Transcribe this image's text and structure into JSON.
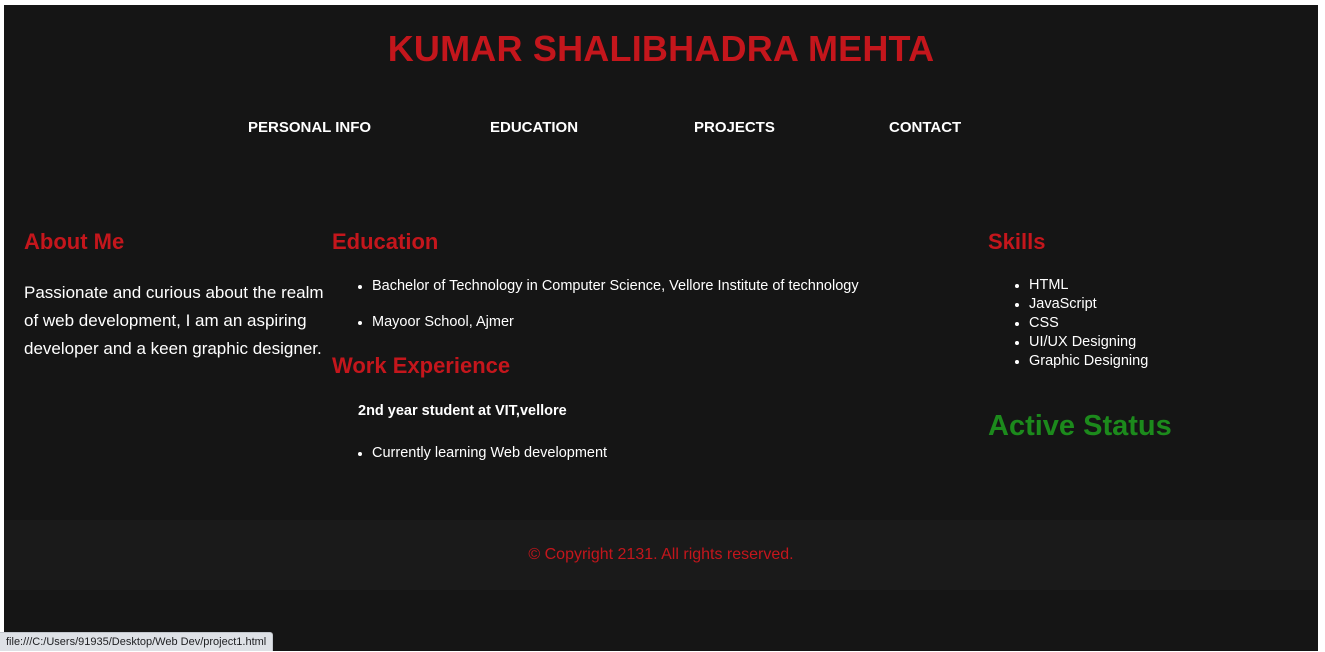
{
  "header": {
    "title": "KUMAR SHALIBHADRA MEHTA"
  },
  "nav": {
    "items": [
      {
        "label": "PERSONAL INFO"
      },
      {
        "label": "EDUCATION"
      },
      {
        "label": "PROJECTS"
      },
      {
        "label": "CONTACT"
      }
    ]
  },
  "about": {
    "heading": "About Me",
    "text": "Passionate and curious about the realm of web development, I am an aspiring developer and a keen graphic designer."
  },
  "education": {
    "heading": "Education",
    "items": [
      "Bachelor of Technology in Computer Science, Vellore Institute of technology",
      "Mayoor School, Ajmer"
    ]
  },
  "work": {
    "heading": "Work Experience",
    "role": "2nd year student at VIT,vellore",
    "items": [
      "Currently learning Web development"
    ]
  },
  "skills": {
    "heading": "Skills",
    "items": [
      "HTML",
      "JavaScript",
      "CSS",
      "UI/UX Designing",
      "Graphic Designing"
    ]
  },
  "status": {
    "label": "Active Status"
  },
  "footer": {
    "text": "© Copyright 2131. All rights reserved."
  },
  "browser": {
    "status_url": "file:///C:/Users/91935/Desktop/Web Dev/project1.html"
  },
  "colors": {
    "background": "#151515",
    "footer_background": "#1a1a1a",
    "accent_red": "#c4161c",
    "status_green": "#1c8a1c",
    "text": "#ffffff"
  }
}
